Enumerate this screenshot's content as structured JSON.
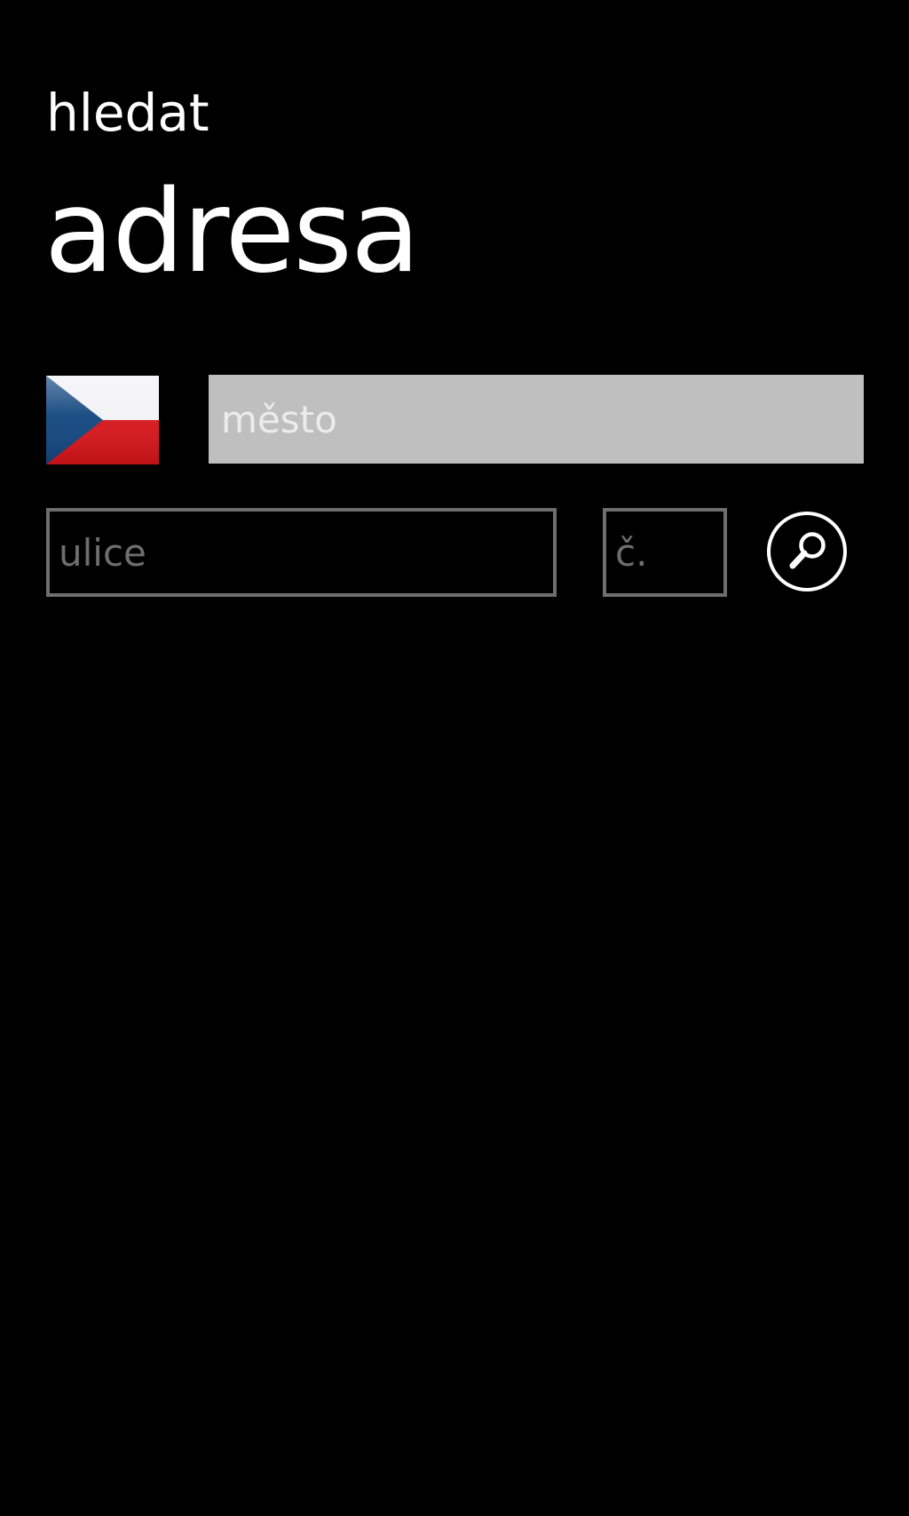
{
  "header": {
    "subtitle": "hledat",
    "title": "adresa"
  },
  "country_flag": {
    "icon": "czech-flag-icon",
    "colors": {
      "white": "#f2f2f7",
      "red": "#d7141a",
      "blue": "#11457e"
    }
  },
  "fields": {
    "city": {
      "value": "",
      "placeholder": "město"
    },
    "street": {
      "value": "",
      "placeholder": "ulice"
    },
    "number": {
      "value": "",
      "placeholder": "č."
    }
  },
  "search_button": {
    "icon": "search-icon"
  },
  "colors": {
    "background": "#000000",
    "foreground": "#ffffff",
    "active_field": "#bfbfbf",
    "field_border": "#6e6e6e"
  }
}
